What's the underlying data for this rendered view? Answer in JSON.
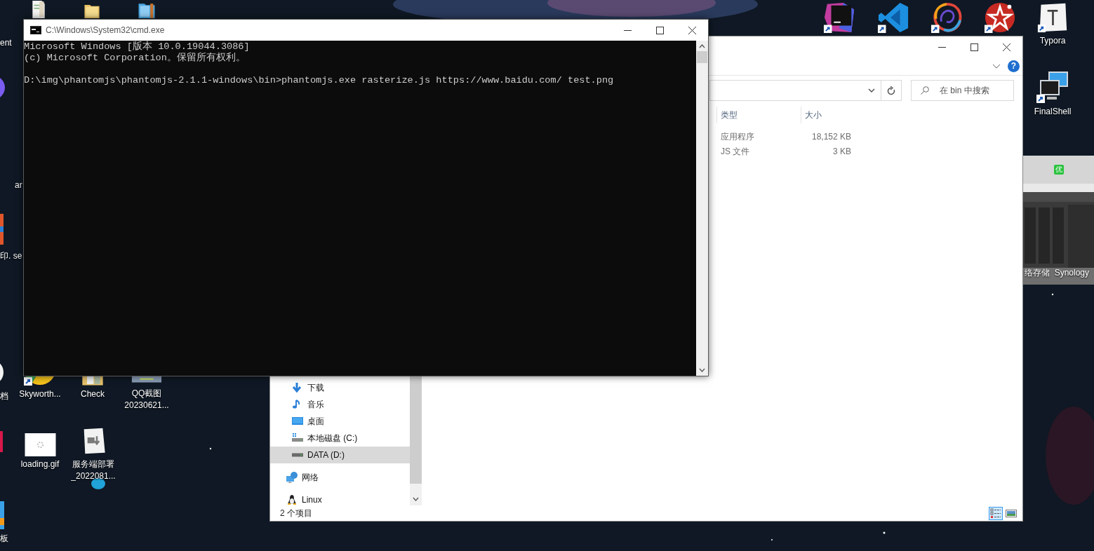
{
  "desktop": {
    "icons": [
      {
        "kind": "document"
      },
      {
        "kind": "folder"
      },
      {
        "kind": "archive"
      },
      {
        "kind": "browser",
        "label": "Skyworth..."
      },
      {
        "kind": "folder-docs",
        "label": "Check"
      },
      {
        "kind": "screenshot",
        "label": "QQ截图 20230621..."
      },
      {
        "kind": "loading",
        "label": "loading.gif"
      },
      {
        "kind": "markdown",
        "label": "服务端部署 _2022081..."
      },
      {
        "kind": "ide"
      },
      {
        "kind": "editor"
      },
      {
        "kind": "ring"
      },
      {
        "kind": "star"
      },
      {
        "kind": "typora",
        "label": "Typora"
      },
      {
        "kind": "monitors",
        "label": "FinalShell"
      }
    ],
    "edge_labels": [
      "ent",
      "ar",
      "印. se",
      "档",
      "板"
    ]
  },
  "ad_panel": {
    "badge": "优",
    "caption": "络存储  Synology"
  },
  "explorer": {
    "help": "?",
    "search": {
      "placeholder": "在 bin 中搜索"
    },
    "columns": [
      "类型",
      "大小"
    ],
    "rows": [
      {
        "type": "应用程序",
        "size": "18,152 KB"
      },
      {
        "type": "JS 文件",
        "size": "3 KB"
      }
    ],
    "nav": {
      "pc_items": [
        {
          "label": "下载",
          "kind": "download",
          "selected": false
        },
        {
          "label": "音乐",
          "kind": "music",
          "selected": false
        },
        {
          "label": "桌面",
          "kind": "desktop",
          "selected": false
        },
        {
          "label": "本地磁盘 (C:)",
          "kind": "system-drive",
          "selected": false
        },
        {
          "label": "DATA (D:)",
          "kind": "drive",
          "selected": true
        }
      ],
      "root_items": [
        {
          "label": "网络",
          "kind": "network",
          "selected": false
        },
        {
          "label": "Linux",
          "kind": "linux",
          "selected": false
        }
      ]
    },
    "status": "2 个项目",
    "views": [
      {
        "kind": "details",
        "selected": true
      },
      {
        "kind": "tiles",
        "selected": false
      }
    ]
  },
  "cmd": {
    "title": "C:\\Windows\\System32\\cmd.exe",
    "blocks": [
      [
        "Microsoft Windows [版本 10.0.19044.3086]",
        "(c) Microsoft Corporation。保留所有权利。"
      ],
      [
        "D:\\img\\phantomjs\\phantomjs-2.1.1-windows\\bin>phantomjs.exe rasterize.js https://www.baidu.com/ test.png"
      ]
    ]
  }
}
